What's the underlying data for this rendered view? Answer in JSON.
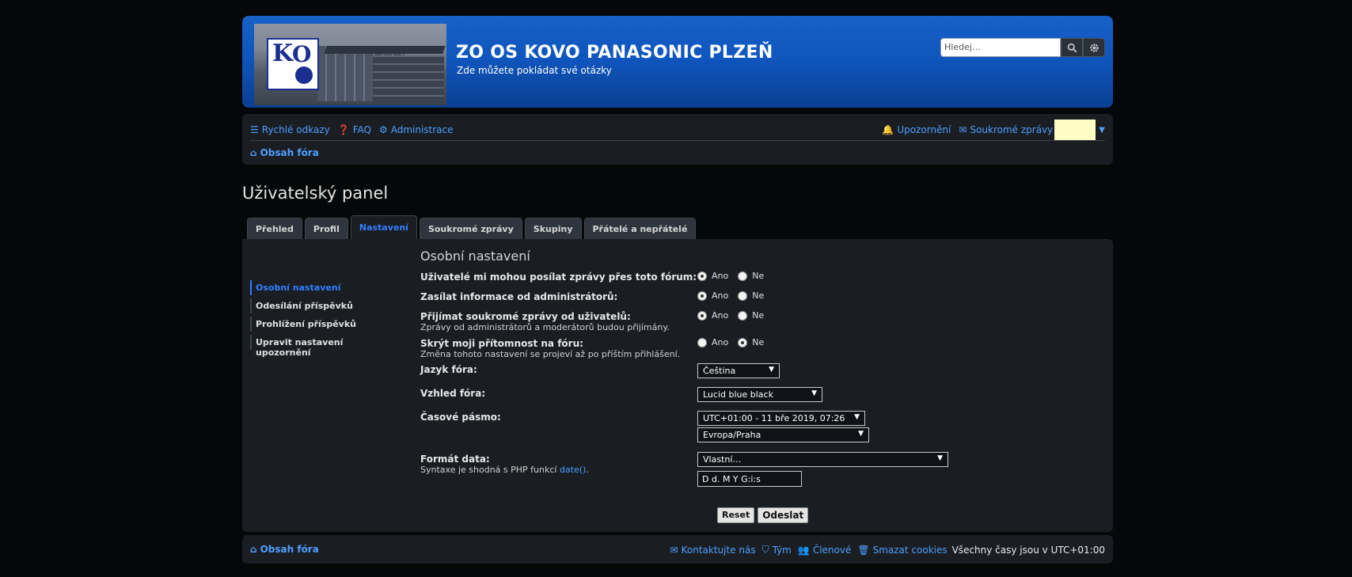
{
  "header": {
    "title": "ZO OS KOVO PANASONIC PLZEŇ",
    "description": "Zde můžete pokládat své otázky",
    "search_placeholder": "Hledej…"
  },
  "nav": {
    "quick_links": "Rychlé odkazy",
    "faq": "FAQ",
    "admin": "Administrace",
    "notifications": "Upozornění",
    "private_messages": "Soukromé zprávy",
    "breadcrumb": "Obsah fóra"
  },
  "page_title": "Uživatelský panel",
  "tabs": [
    {
      "label": "Přehled"
    },
    {
      "label": "Profil"
    },
    {
      "label": "Nastavení"
    },
    {
      "label": "Soukromé zprávy"
    },
    {
      "label": "Skupiny"
    },
    {
      "label": "Přátelé a nepřátelé"
    }
  ],
  "sidenav": [
    {
      "label": "Osobní nastavení"
    },
    {
      "label": "Odesílání příspěvků"
    },
    {
      "label": "Prohlížení příspěvků"
    },
    {
      "label": "Upravit nastavení upozornění"
    }
  ],
  "form": {
    "section_title": "Osobní nastavení",
    "yes": "Ano",
    "no": "Ne",
    "allow_pm_label": "Uživatelé mi mohou posílat zprávy přes toto fórum:",
    "admin_info_label": "Zasílat informace od administrátorů:",
    "receive_pm_label": "Přijímat soukromé zprávy od uživatelů:",
    "receive_pm_sub": "Zprávy od administrátorů a moderátorů budou přijímány.",
    "hide_online_label": "Skrýt moji přítomnost na fóru:",
    "hide_online_sub": "Změna tohoto nastavení se projeví až po příštím přihlášení.",
    "language_label": "Jazyk fóra:",
    "language_value": "Čeština",
    "style_label": "Vzhled fóra:",
    "style_value": "Lucid blue black",
    "timezone_label": "Časové pásmo:",
    "timezone_value": "UTC+01:00 - 11 bře 2019, 07:26",
    "timezone_region": "Evropa/Praha",
    "dateformat_label": "Formát data:",
    "dateformat_sub": "Syntaxe je shodná s PHP funkcí",
    "dateformat_link": "date()",
    "dateformat_dot": ".",
    "dateformat_select": "Vlastní…",
    "dateformat_value": "D d. M Y G:i:s",
    "reset": "Reset",
    "submit": "Odeslat"
  },
  "footer": {
    "breadcrumb": "Obsah fóra",
    "contact": "Kontaktujte nás",
    "team": "Tým",
    "members": "Členové",
    "delete_cookies": "Smazat cookies",
    "timezone_note": "Všechny časy jsou v UTC+01:00"
  }
}
